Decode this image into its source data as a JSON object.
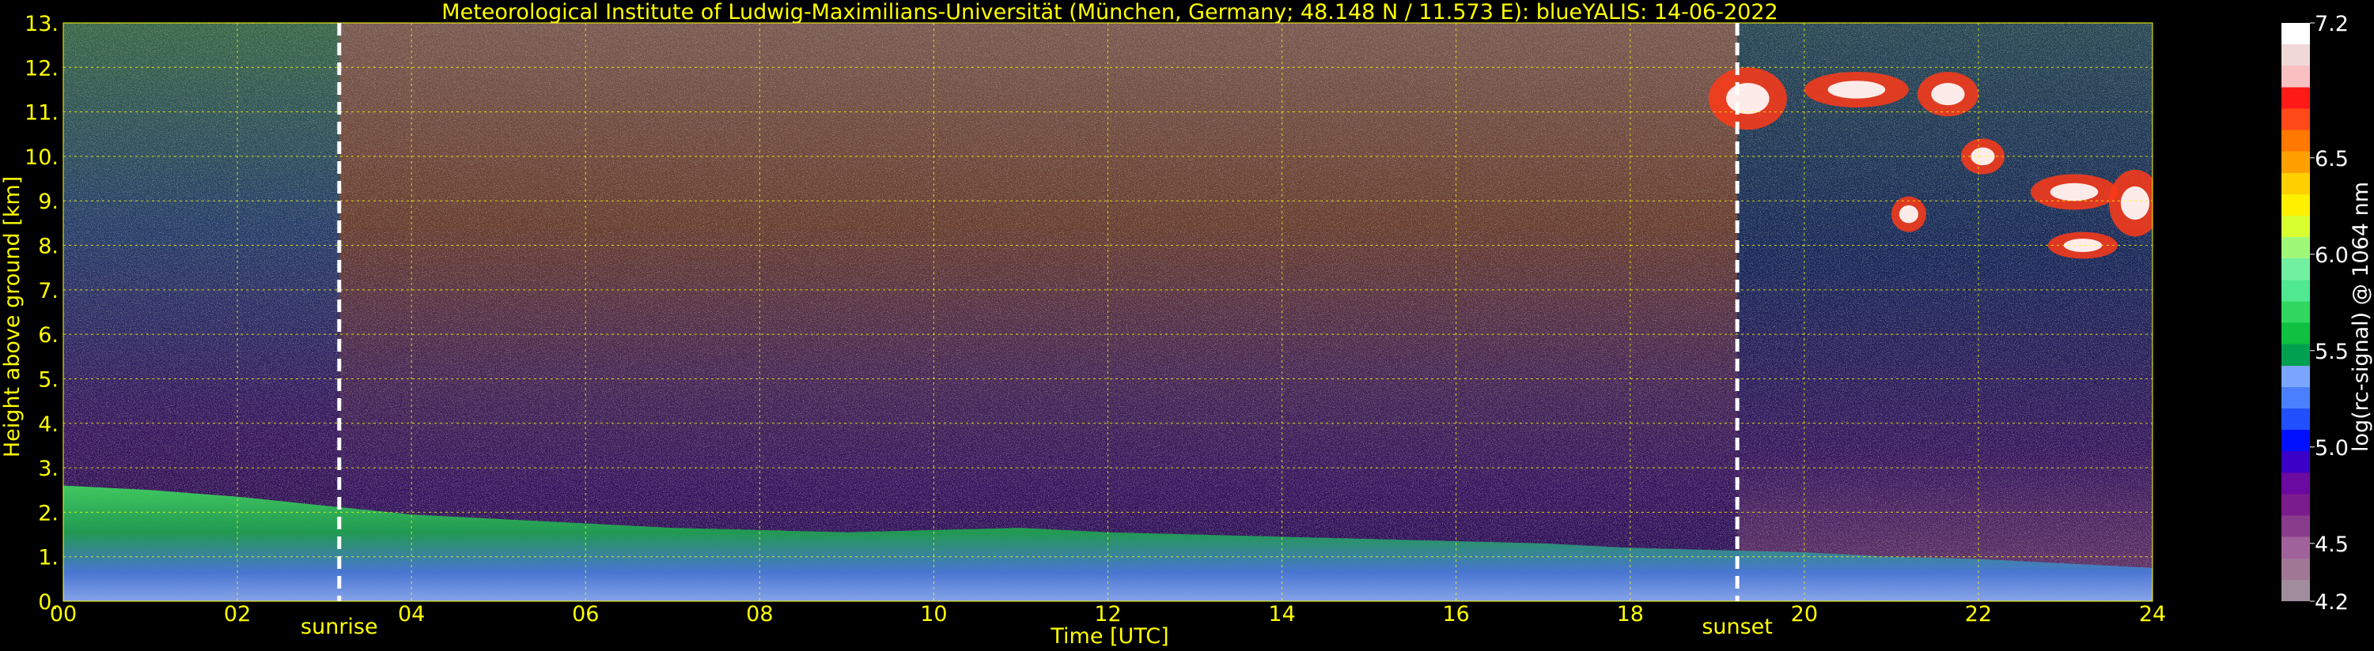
{
  "chart_data": {
    "type": "heatmap",
    "title": "Meteorological Institute of Ludwig-Maximilians-Universität (München, Germany; 48.148 N / 11.573 E):     blueYALIS: 14-06-2022",
    "xlabel": "Time [UTC]",
    "ylabel": "Height above ground [km]",
    "xlim": [
      0,
      24
    ],
    "ylim": [
      0,
      13
    ],
    "x_ticks": [
      "00",
      "02",
      "04",
      "06",
      "08",
      "10",
      "12",
      "14",
      "16",
      "18",
      "20",
      "22",
      "24"
    ],
    "y_ticks": [
      "0.",
      "1.",
      "2.",
      "3.",
      "4.",
      "5.",
      "6.",
      "7.",
      "8.",
      "9.",
      "10.",
      "11.",
      "12.",
      "13."
    ],
    "grid": true,
    "colorbar": {
      "label": "log(rc-signal) @ 1064 nm",
      "range": [
        4.2,
        7.2
      ],
      "ticks": [
        "7.2",
        "6.5",
        "6.0",
        "5.5",
        "5.0",
        "4.5",
        "4.2"
      ],
      "tick_values": [
        7.2,
        6.5,
        6.0,
        5.5,
        5.0,
        4.5,
        4.2
      ],
      "colors": [
        "#a08c9a",
        "#a07896",
        "#a0629a",
        "#8a3c8c",
        "#7a1c8c",
        "#6a0aa0",
        "#3a00c8",
        "#0010ff",
        "#2050ff",
        "#4a80ff",
        "#7aa6ff",
        "#00a050",
        "#10c040",
        "#30d860",
        "#50e890",
        "#70f0a0",
        "#a0f878",
        "#d8ff30",
        "#fff000",
        "#ffd000",
        "#ffa000",
        "#ff7800",
        "#ff4a18",
        "#ff1a18",
        "#f8c0c0",
        "#f0d8d8",
        "#ffffff"
      ]
    },
    "annotations": [
      {
        "label": "sunrise",
        "x": 3.17
      },
      {
        "label": "sunset",
        "x": 19.23
      }
    ],
    "boundary_layer_top_km": {
      "x": [
        0,
        1,
        2,
        3,
        4,
        5,
        6,
        7,
        8,
        9,
        10,
        11,
        12,
        13,
        14,
        15,
        16,
        17,
        18,
        19,
        20,
        21,
        22,
        23,
        24
      ],
      "y": [
        2.6,
        2.5,
        2.35,
        2.15,
        1.95,
        1.85,
        1.75,
        1.65,
        1.6,
        1.55,
        1.6,
        1.65,
        1.55,
        1.5,
        1.45,
        1.4,
        1.35,
        1.3,
        1.2,
        1.15,
        1.1,
        1.0,
        0.95,
        0.85,
        0.75
      ]
    },
    "clouds": [
      {
        "x": 18.9,
        "y": 10.6,
        "w": 0.9,
        "h": 1.4
      },
      {
        "x": 20.0,
        "y": 11.1,
        "w": 1.2,
        "h": 0.8
      },
      {
        "x": 21.3,
        "y": 10.9,
        "w": 0.7,
        "h": 1.0
      },
      {
        "x": 21.8,
        "y": 9.6,
        "w": 0.5,
        "h": 0.8
      },
      {
        "x": 22.6,
        "y": 8.8,
        "w": 1.0,
        "h": 0.8
      },
      {
        "x": 23.5,
        "y": 8.2,
        "w": 0.6,
        "h": 1.5
      },
      {
        "x": 22.8,
        "y": 7.7,
        "w": 0.8,
        "h": 0.6
      },
      {
        "x": 21.0,
        "y": 8.3,
        "w": 0.4,
        "h": 0.8
      }
    ]
  }
}
